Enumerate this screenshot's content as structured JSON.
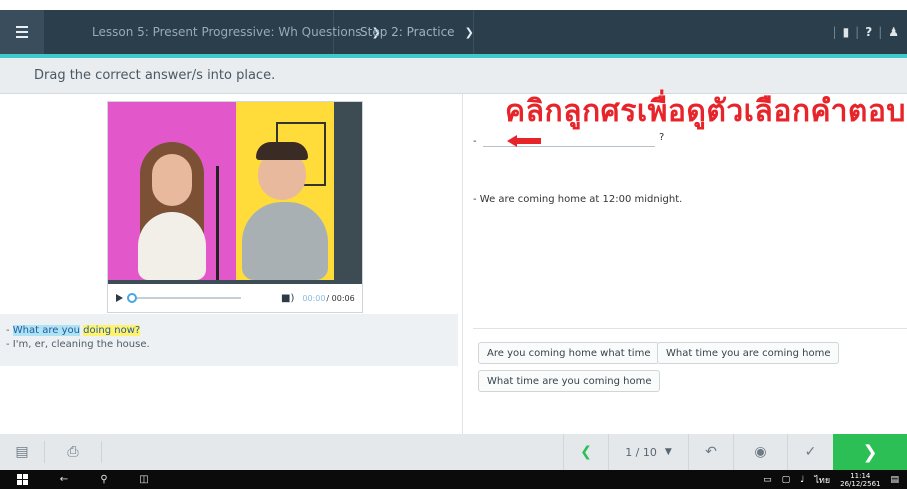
{
  "topbar": {
    "lesson_title": "Lesson 5: Present Progressive: Wh Questions",
    "step_title": "Step 2: Practice"
  },
  "instruction": "Drag the correct answer/s into place.",
  "video": {
    "time_current": "00:00",
    "time_total": "/ 00:06"
  },
  "dialog": {
    "line1_prefix": "- ",
    "line1_part1": "What are you",
    "line1_part2": "doing now?",
    "line2": "- I'm, er, cleaning the house."
  },
  "right": {
    "thai_hint": "คลิกลูกศรเพื่อดูตัวเลือกคำตอบ",
    "blank_prefix": "-",
    "question_mark": "?",
    "answer_sentence": "- We are coming home at 12:00 midnight."
  },
  "options": [
    "Are you coming home what time",
    "What time you are coming home",
    "What time are you coming home"
  ],
  "bottombar": {
    "page": "1 / 10"
  },
  "taskbar": {
    "lang": "ไทย",
    "time": "11:14",
    "date": "26/12/2561"
  },
  "colors": {
    "topbar": "#2b3e4c",
    "accent_stripe": "#3ec9cb",
    "next_button": "#2bbf55",
    "hint_red": "#e8242b"
  }
}
